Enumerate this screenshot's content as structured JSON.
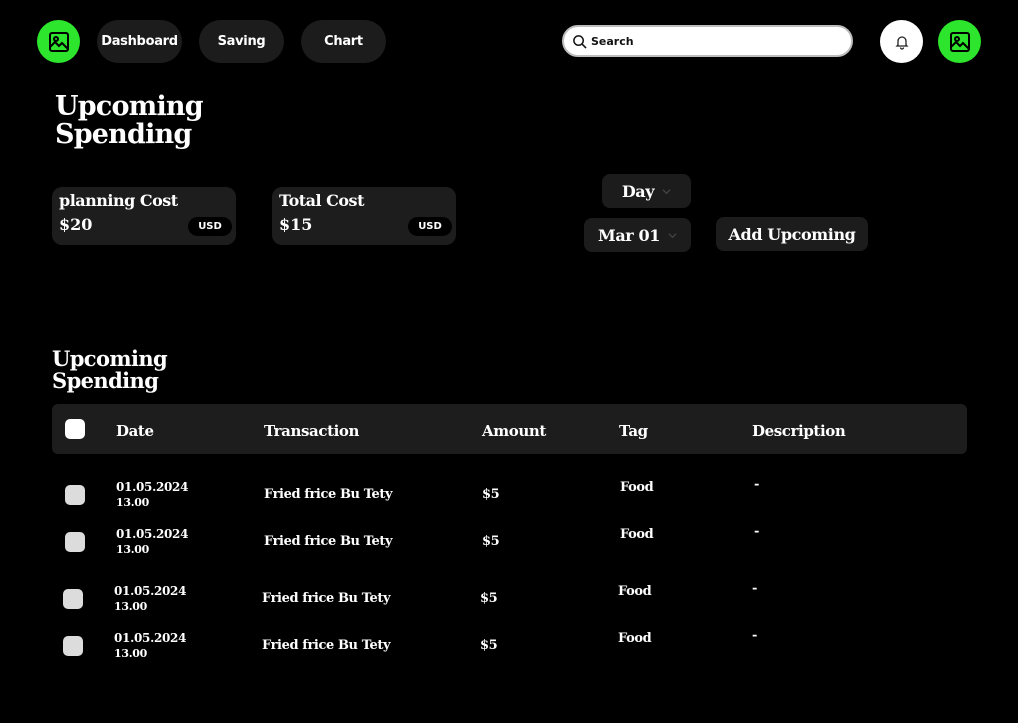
{
  "header": {
    "nav": [
      "Dashboard",
      "Saving",
      "Chart"
    ],
    "search_placeholder": "Search",
    "logo_icon": "image-icon",
    "avatar_icon": "image-icon",
    "bell_icon": "bell-icon",
    "accent": "#2ce52c"
  },
  "summary": {
    "title_line1": "Upcoming",
    "title_line2": "Spending",
    "planning": {
      "label": "planning Cost",
      "value": "$20",
      "currency": "USD"
    },
    "total": {
      "label": "Total Cost",
      "value": "$15",
      "currency": "USD"
    },
    "period": "Day",
    "date": "Mar 01",
    "add_label": "Add Upcoming"
  },
  "table": {
    "title_line1": "Upcoming",
    "title_line2": "Spending",
    "columns": [
      "Date",
      "Transaction",
      "Amount",
      "Tag",
      "Description"
    ],
    "rows": [
      {
        "date": "01.05.2024",
        "time": "13.00",
        "transaction": "Fried frice Bu Tety",
        "amount": "$5",
        "tag": "Food",
        "description": "-"
      },
      {
        "date": "01.05.2024",
        "time": "13.00",
        "transaction": "Fried frice Bu Tety",
        "amount": "$5",
        "tag": "Food",
        "description": "-"
      },
      {
        "date": "01.05.2024",
        "time": "13.00",
        "transaction": "Fried frice Bu Tety",
        "amount": "$5",
        "tag": "Food",
        "description": "-"
      },
      {
        "date": "01.05.2024",
        "time": "13.00",
        "transaction": "Fried frice Bu Tety",
        "amount": "$5",
        "tag": "Food",
        "description": "-"
      }
    ]
  }
}
